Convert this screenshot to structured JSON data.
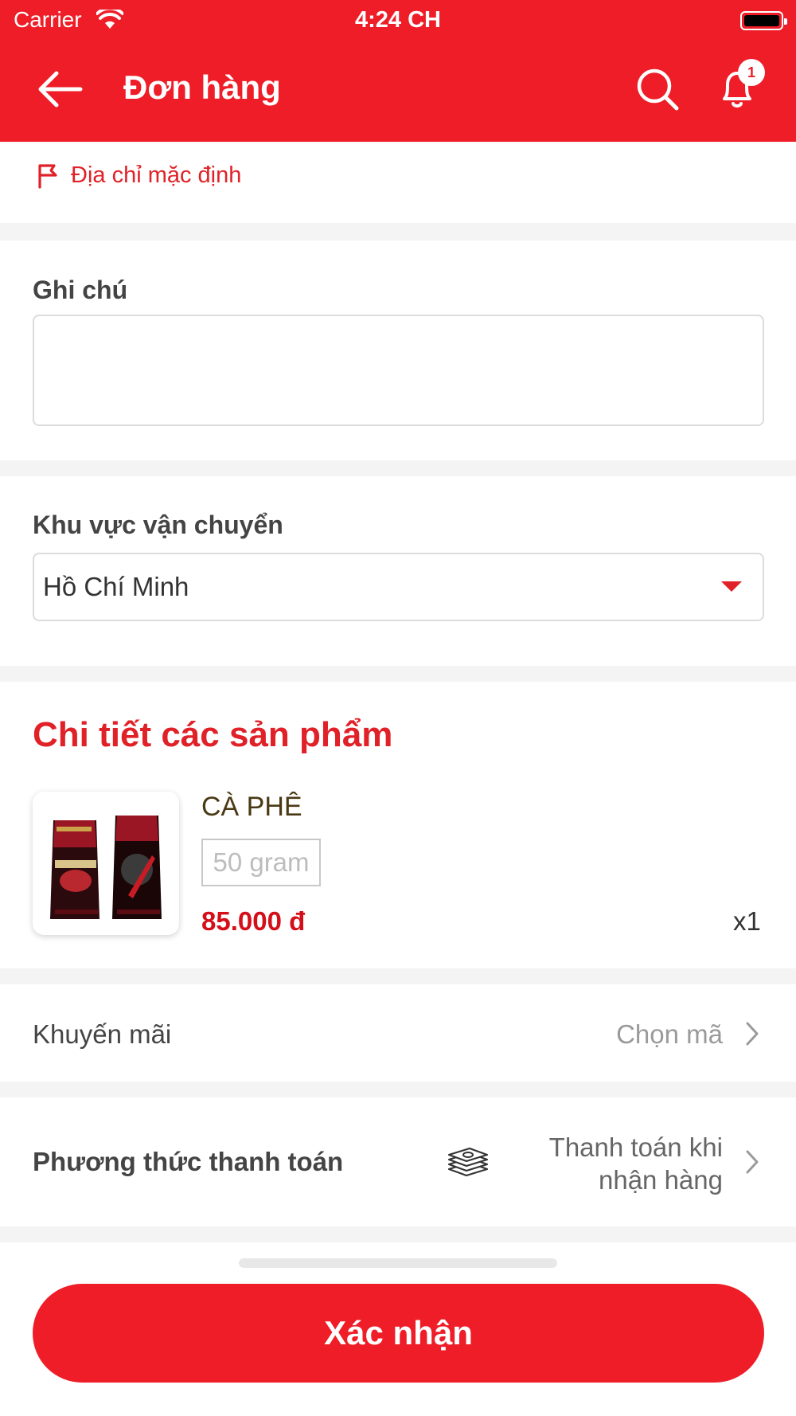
{
  "status_bar": {
    "carrier": "Carrier",
    "time": "4:24 CH"
  },
  "header": {
    "title": "Đơn hàng",
    "notification_count": "1",
    "accent_color": "#ee1d27"
  },
  "address": {
    "default_label": "Địa chỉ mặc định"
  },
  "note": {
    "label": "Ghi chú",
    "value": "",
    "placeholder": ""
  },
  "shipping": {
    "label": "Khu vực vận chuyển",
    "selected": "Hồ Chí Minh"
  },
  "products": {
    "title": "Chi tiết các sản phẩm",
    "items": [
      {
        "name": "CÀ PHÊ",
        "variant": "50 gram",
        "price": "85.000 đ",
        "quantity": "x1",
        "image_icon": "coffee-bag-image"
      }
    ]
  },
  "promotion": {
    "label": "Khuyến mãi",
    "value": "Chọn mã"
  },
  "payment": {
    "label": "Phương thức thanh toán",
    "icon": "cash-stack-icon",
    "value": "Thanh toán khi nhận hàng"
  },
  "footer": {
    "confirm_label": "Xác nhận"
  }
}
